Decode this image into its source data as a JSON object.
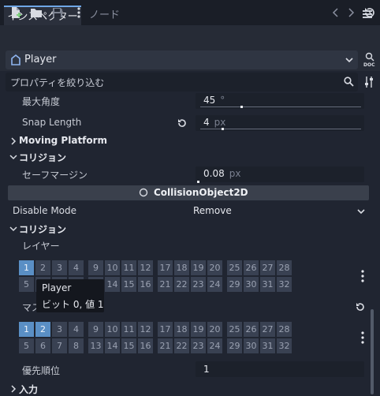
{
  "tabs": {
    "inspector": "インスペクター",
    "node": "ノード"
  },
  "object": {
    "name": "Player"
  },
  "filter": {
    "placeholder": "プロパティを絞り込む"
  },
  "rows": {
    "max_angle": {
      "label": "最大角度",
      "value": "45",
      "unit": "°",
      "level": 0.25
    },
    "snap_length": {
      "label": "Snap Length",
      "value": "4",
      "unit": "px",
      "level": 0.13
    },
    "moving_platform": "Moving Platform",
    "collision_section": "コリジョン",
    "safe_margin": {
      "label": "セーフマージン",
      "value": "0.08",
      "unit": "px"
    },
    "class_header": "CollisionObject2D",
    "disable_mode": {
      "label": "Disable Mode",
      "value": "Remove"
    },
    "collision_section2": "コリジョン",
    "layer": "レイヤー",
    "mask": "マスク",
    "priority": {
      "label": "優先順位",
      "value": "1"
    },
    "input_section": "入力"
  },
  "layer_bits": {
    "row1": [
      "1",
      "2",
      "3",
      "4",
      "9",
      "10",
      "11",
      "12",
      "17",
      "18",
      "19",
      "20",
      "25",
      "26",
      "27",
      "28"
    ],
    "row2": [
      "5",
      "",
      "",
      "",
      "",
      "14",
      "15",
      "16",
      "21",
      "22",
      "23",
      "24",
      "29",
      "30",
      "31",
      "32"
    ],
    "on": [
      "1"
    ]
  },
  "mask_bits": {
    "row1": [
      "1",
      "2",
      "3",
      "4",
      "9",
      "10",
      "11",
      "12",
      "17",
      "18",
      "19",
      "20",
      "25",
      "26",
      "27",
      "28"
    ],
    "row2": [
      "5",
      "6",
      "7",
      "8",
      "13",
      "14",
      "15",
      "16",
      "21",
      "22",
      "23",
      "24",
      "29",
      "30",
      "31",
      "32"
    ],
    "on": [
      "1",
      "2"
    ]
  },
  "tooltip": {
    "title": "Player",
    "detail": "ビット 0, 値 1"
  }
}
